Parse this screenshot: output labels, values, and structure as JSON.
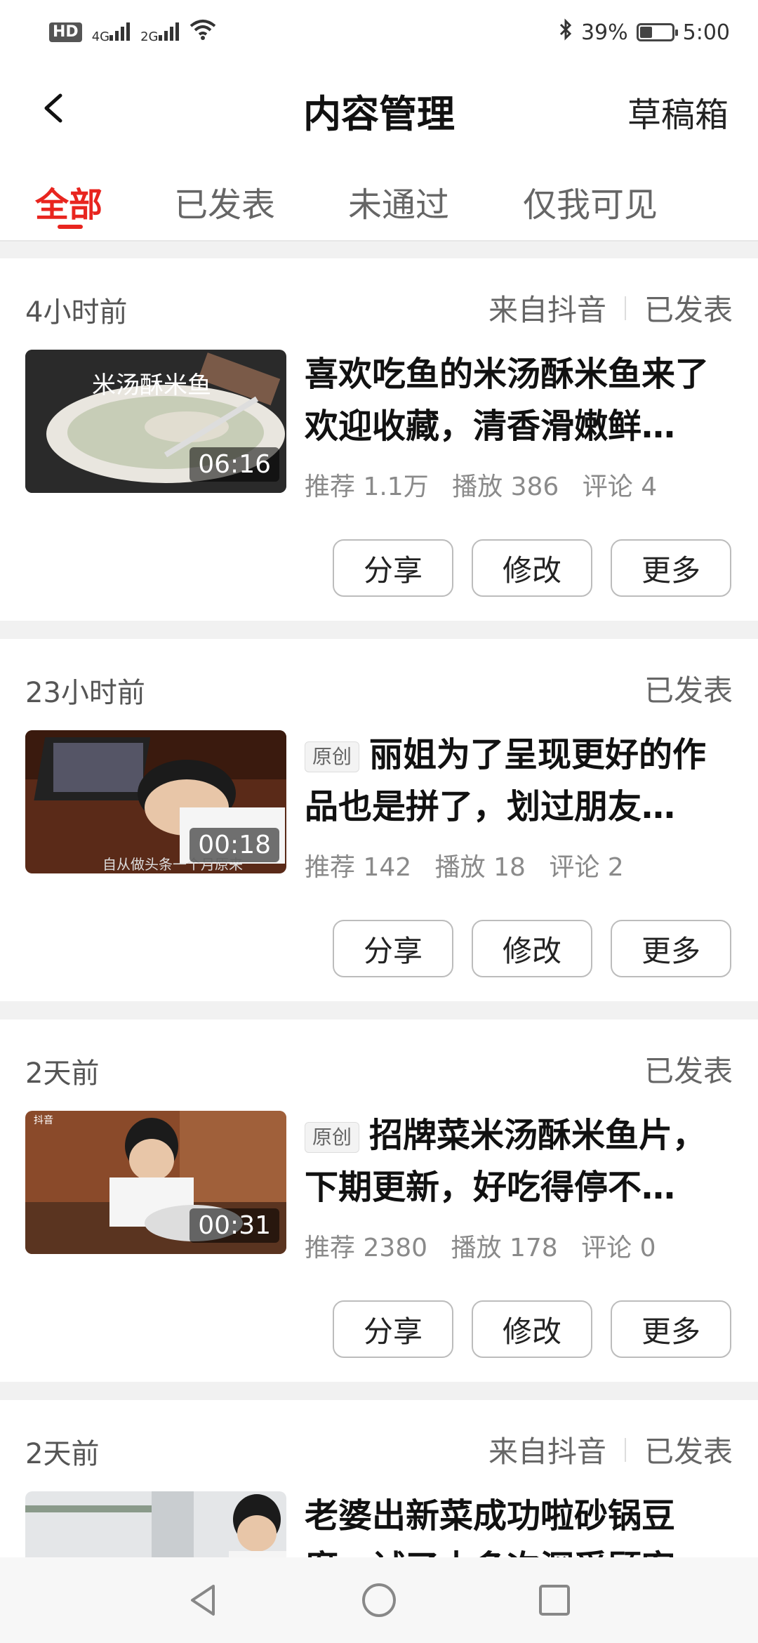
{
  "status_bar": {
    "hd_label": "HD",
    "signal1": "4G",
    "signal2": "2G",
    "battery_text": "39%",
    "battery_level": 0.39,
    "time": "5:00"
  },
  "header": {
    "title": "内容管理",
    "right_action": "草稿箱"
  },
  "tabs": [
    {
      "label": "全部",
      "active": true
    },
    {
      "label": "已发表",
      "active": false
    },
    {
      "label": "未通过",
      "active": false
    },
    {
      "label": "仅我可见",
      "active": false
    }
  ],
  "buttons": {
    "share": "分享",
    "edit": "修改",
    "more": "更多"
  },
  "items": [
    {
      "time": "4小时前",
      "source": "来自抖音",
      "status": "已发表",
      "thumb_text": "米汤酥米鱼",
      "duration": "06:16",
      "original": "",
      "title": "喜欢吃鱼的米汤酥米鱼来了欢迎收藏，清香滑嫩鲜…",
      "stats": {
        "rec": "推荐 1.1万",
        "play": "播放 386",
        "comment": "评论 4"
      }
    },
    {
      "time": "23小时前",
      "source": "",
      "status": "已发表",
      "thumb_text": "自从做头条一个月原来",
      "duration": "00:18",
      "original": "原创",
      "title": "丽姐为了呈现更好的作品也是拼了，划过朋友…",
      "stats": {
        "rec": "推荐 142",
        "play": "播放 18",
        "comment": "评论 2"
      }
    },
    {
      "time": "2天前",
      "source": "",
      "status": "已发表",
      "thumb_text": "抖音",
      "duration": "00:31",
      "original": "原创",
      "title": "招牌菜米汤酥米鱼片，下期更新，好吃得停不…",
      "stats": {
        "rec": "推荐 2380",
        "play": "播放 178",
        "comment": "评论 0"
      }
    },
    {
      "time": "2天前",
      "source": "来自抖音",
      "status": "已发表",
      "thumb_text": "",
      "duration": "",
      "original": "",
      "title": "老婆出新菜成功啦砂锅豆腐，试了十多次深受顾客…",
      "stats": {
        "rec": "",
        "play": "",
        "comment": ""
      }
    }
  ],
  "colors": {
    "accent": "#e8251f"
  }
}
